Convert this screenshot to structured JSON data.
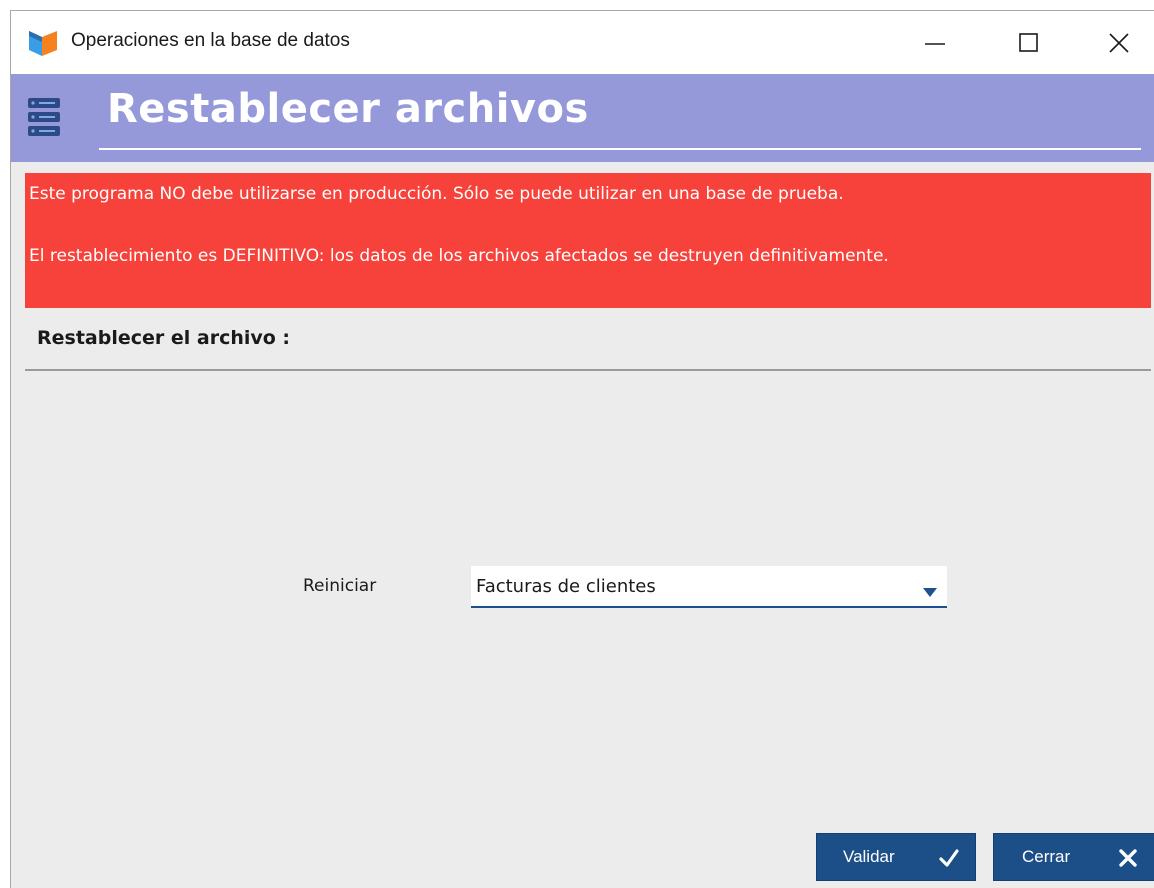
{
  "window": {
    "title": "Operaciones en la base de datos",
    "icons": {
      "app": "app-logo-icon",
      "minimize": "minimize-icon",
      "maximize": "maximize-icon",
      "close": "close-icon"
    }
  },
  "header": {
    "title": "Restablecer archivos",
    "icon": "database-icon",
    "background": "#9599da"
  },
  "alert": {
    "line1": "Este programa NO debe utilizarse en producción. Sólo se puede utilizar en una base de prueba.",
    "line2": "El restablecimiento es DEFINITIVO: los datos de los archivos afectados se destruyen definitivamente.",
    "background": "#f6423a"
  },
  "section": {
    "title": "Restablecer el archivo :"
  },
  "form": {
    "label": "Reiniciar",
    "selected": "Facturas de clientes",
    "dropdown_icon": "caret-down-icon"
  },
  "buttons": {
    "validate_label": "Validar",
    "validate_icon": "check-icon",
    "close_label": "Cerrar",
    "close_icon": "close-icon",
    "color": "#1c4f88"
  }
}
